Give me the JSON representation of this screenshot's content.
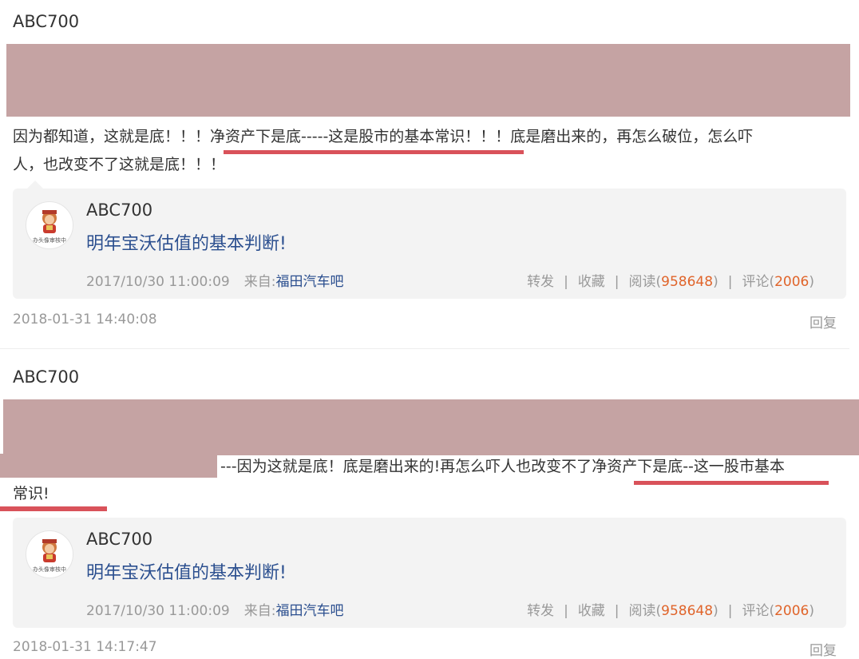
{
  "comments": [
    {
      "author": "ABC700",
      "line1_a": "因为都知道，这就是底！！！",
      "line1_b": "净资产下是底-----这是股市的基本常识",
      "line1_c": "！！！底是磨出来的，再怎么破位，怎么吓",
      "line2": "人，也改变不了这就是底！！！",
      "time": "2018-01-31 14:40:08",
      "reply": "回复"
    },
    {
      "author": "ABC700",
      "line1_a": "---因为这就是底！底是磨出来的!再怎么吓人也改变不了",
      "line1_b": "净资产下是底--这一股市基本",
      "line2": "常识!",
      "time": "2018-01-31 14:17:47",
      "reply": "回复"
    }
  ],
  "quoted_post": {
    "author": "ABC700",
    "title": "明年宝沃估值的基本判断!",
    "date": "2017/10/30 11:00:09",
    "source_label": "来自:",
    "source": "福田汽车吧",
    "forward": "转发",
    "favorite": "收藏",
    "read_label": "阅读(",
    "read_count": "958648",
    "comment_label": "评论(",
    "comment_count": "2006",
    "close_paren": ")",
    "sep": "|",
    "avatar_caption": "办头像审核中"
  },
  "colors": {
    "redaction": "#c5a3a3",
    "underline": "#d9525a",
    "link": "#2b4f8f",
    "count": "#e0642a"
  }
}
